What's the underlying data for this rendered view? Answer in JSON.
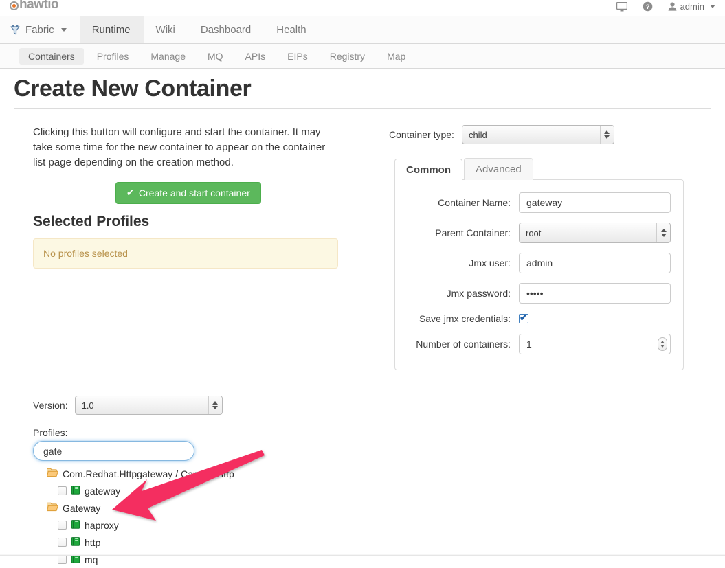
{
  "brand": {
    "logo_text": "hawtio",
    "icons": [
      "monitor-icon",
      "help-icon"
    ],
    "user_label": "admin"
  },
  "main_nav": {
    "fabric_label": "Fabric",
    "items": [
      {
        "label": "Runtime",
        "active": true
      },
      {
        "label": "Wiki",
        "active": false
      },
      {
        "label": "Dashboard",
        "active": false
      },
      {
        "label": "Health",
        "active": false
      }
    ]
  },
  "sub_nav": {
    "items": [
      {
        "label": "Containers",
        "active": true
      },
      {
        "label": "Profiles",
        "active": false
      },
      {
        "label": "Manage",
        "active": false
      },
      {
        "label": "MQ",
        "active": false
      },
      {
        "label": "APIs",
        "active": false
      },
      {
        "label": "EIPs",
        "active": false
      },
      {
        "label": "Registry",
        "active": false
      },
      {
        "label": "Map",
        "active": false
      }
    ]
  },
  "page": {
    "title": "Create New Container"
  },
  "left": {
    "intro": "Clicking this button will configure and start the container. It may take some time for the new container to appear on the container list page depending on the creation method.",
    "create_button": "Create and start container",
    "selected_profiles_heading": "Selected Profiles",
    "no_profiles_message": "No profiles selected",
    "version_label": "Version:",
    "version_value": "1.0",
    "profiles_label": "Profiles:",
    "profiles_filter_value": "gate",
    "profiles_filter_placeholder": "",
    "tree": [
      {
        "type": "folder",
        "label": "Com.Redhat.Httpgateway / Camel / Http"
      },
      {
        "type": "profile",
        "label": "gateway",
        "checked": false
      },
      {
        "type": "folder",
        "label": "Gateway"
      },
      {
        "type": "profile",
        "label": "haproxy",
        "checked": false
      },
      {
        "type": "profile",
        "label": "http",
        "checked": false
      },
      {
        "type": "profile",
        "label": "mq",
        "checked": false
      }
    ]
  },
  "right": {
    "container_type_label": "Container type:",
    "container_type_value": "child",
    "tabs": [
      {
        "label": "Common",
        "active": true
      },
      {
        "label": "Advanced",
        "active": false
      }
    ],
    "fields": {
      "container_name_label": "Container Name:",
      "container_name_value": "gateway",
      "parent_container_label": "Parent Container:",
      "parent_container_value": "root",
      "jmx_user_label": "Jmx user:",
      "jmx_user_value": "admin",
      "jmx_password_label": "Jmx password:",
      "jmx_password_value": "•••••",
      "save_credentials_label": "Save jmx credentials:",
      "save_credentials_checked": true,
      "number_of_containers_label": "Number of containers:",
      "number_of_containers_value": "1"
    }
  },
  "annotation": {
    "arrow_color": "#f42d60",
    "points_to": "http"
  },
  "colors": {
    "green_button": "#5cb85c",
    "alert_bg": "#fcf8e3",
    "alert_text": "#b8924b",
    "folder": "#e8a33d",
    "book": "#1ea83c",
    "focus_blue": "#86b8e0"
  }
}
